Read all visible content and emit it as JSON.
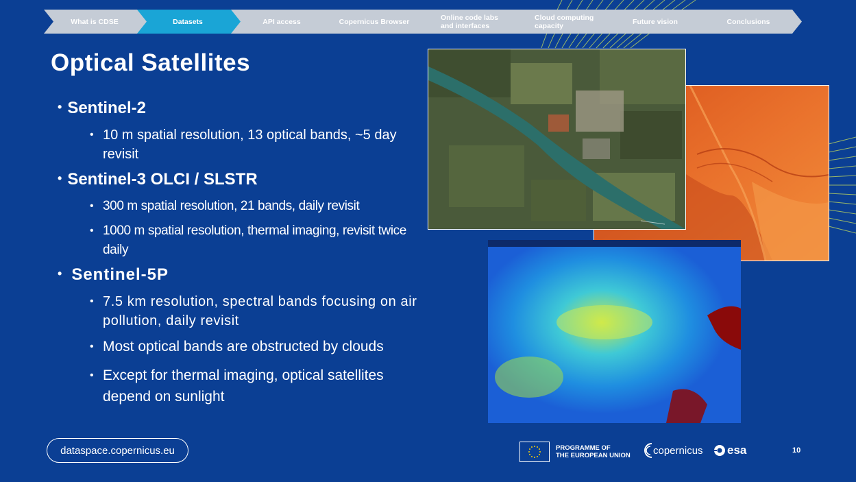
{
  "nav": {
    "items": [
      {
        "label": "What is CDSE",
        "active": false
      },
      {
        "label": "Datasets",
        "active": true
      },
      {
        "label": "API access",
        "active": false
      },
      {
        "label": "Copernicus Browser",
        "active": false
      },
      {
        "label": "Online code labs and interfaces",
        "line1": "Online code labs",
        "line2": "and interfaces",
        "active": false
      },
      {
        "label": "Cloud computing capacity",
        "line1": "Cloud computing",
        "line2": "capacity",
        "active": false
      },
      {
        "label": "Future vision",
        "active": false
      },
      {
        "label": "Conclusions",
        "active": false
      }
    ]
  },
  "title": "Optical Satellites",
  "sections": [
    {
      "heading": "Sentinel-2",
      "points": [
        "10 m spatial resolution, 13 optical bands, ~5 day revisit"
      ]
    },
    {
      "heading": "Sentinel-3 OLCI / SLSTR",
      "points": [
        "300 m spatial resolution, 21 bands, daily revisit",
        "1000 m spatial resolution, thermal imaging, revisit twice daily"
      ]
    },
    {
      "heading": "Sentinel-5P",
      "points": [
        "7.5 km resolution, spectral bands focusing on air pollution, daily revisit",
        "Most optical bands are obstructed by clouds",
        "Except for thermal imaging, optical satellites depend on sunlight"
      ]
    }
  ],
  "footer": {
    "url": "dataspace.copernicus.eu",
    "eu_line1": "PROGRAMME OF",
    "eu_line2": "THE EUROPEAN UNION",
    "copernicus": "copernicus",
    "esa": "esa",
    "page": "10"
  },
  "colors": {
    "background": "#0b3f94",
    "nav_inactive": "#c5ccd6",
    "nav_active": "#1aa5d6",
    "text": "#ffffff"
  },
  "icons": [
    "eu-flag-icon",
    "copernicus-logo-icon",
    "esa-logo-icon"
  ]
}
